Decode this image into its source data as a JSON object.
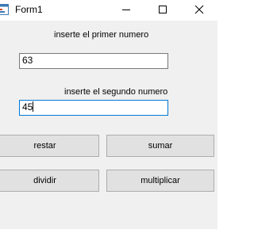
{
  "window": {
    "title": "Form1",
    "icon": "winforms-app-icon",
    "controls": {
      "minimize_icon": "minimize-icon",
      "maximize_icon": "maximize-icon",
      "close_icon": "close-icon"
    }
  },
  "form": {
    "label_first": "inserte el primer numero",
    "first_value": "63",
    "label_second": "inserte el segundo numero",
    "second_value": "45"
  },
  "buttons": {
    "restar": "restar",
    "sumar": "sumar",
    "dividir": "dividir",
    "multiplicar": "multiplicar"
  },
  "colors": {
    "form_background": "#f0f0f0",
    "titlebar_background": "#ffffff",
    "button_background": "#e1e1e1",
    "button_border": "#adadad",
    "focus_border": "#0078d7"
  }
}
